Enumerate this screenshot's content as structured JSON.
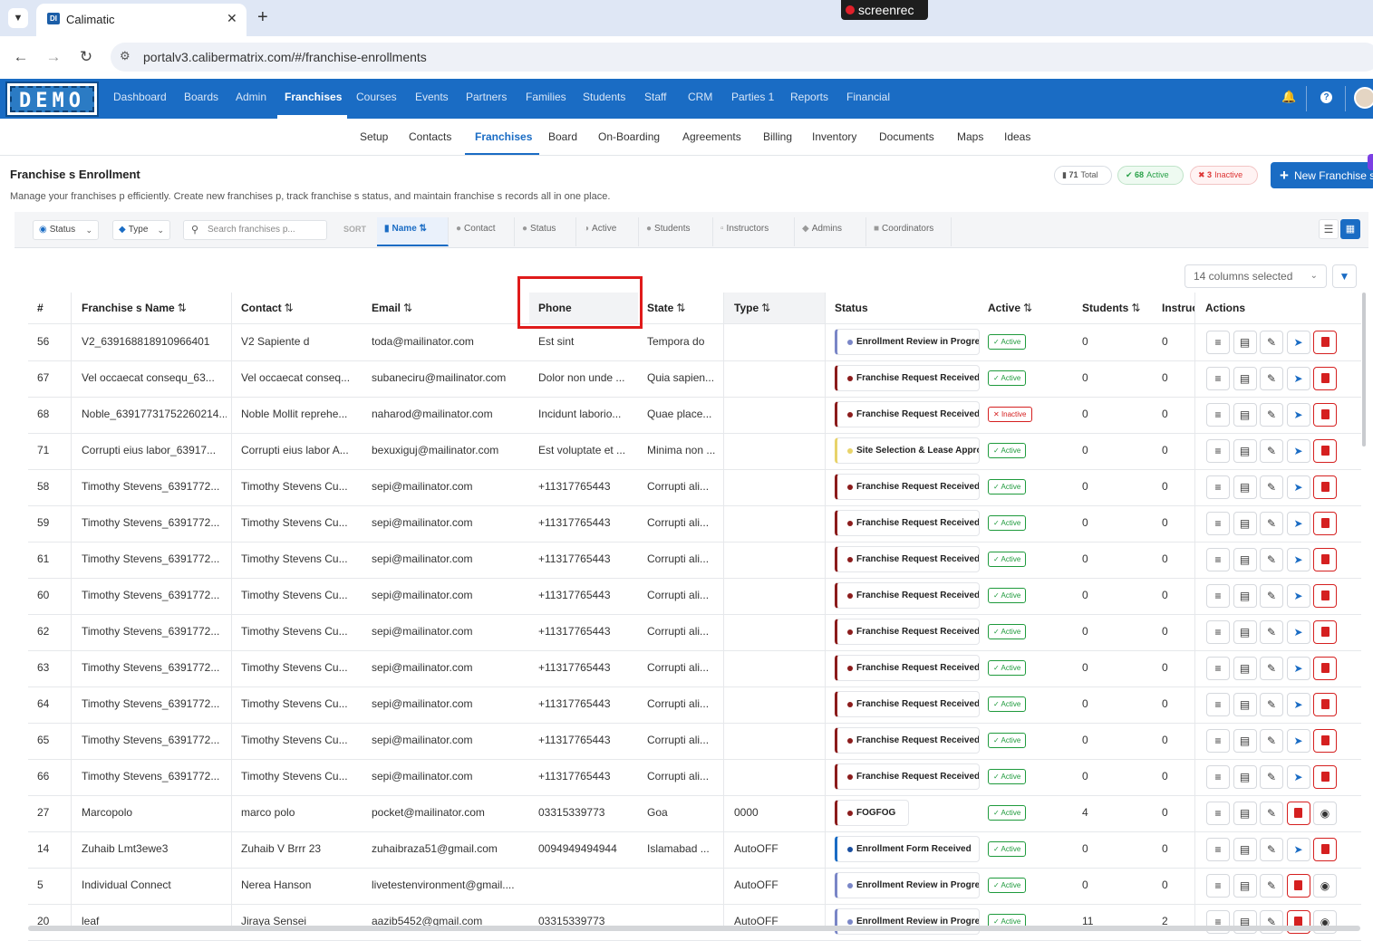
{
  "browser": {
    "tab_title": "Calimatic",
    "favicon_text": "DI",
    "url": "portalv3.calibermatrix.com/#/franchise-enrollments",
    "recorder_label": "screenrec"
  },
  "brand": {
    "logo_text": "DEMO",
    "primary_color": "#1a6cc4"
  },
  "top_nav": [
    "Dashboard",
    "Boards",
    "Admin",
    "Franchises",
    "Courses",
    "Events",
    "Partners",
    "Families",
    "Students",
    "Staff",
    "CRM",
    "Parties 1",
    "Reports",
    "Financial"
  ],
  "top_nav_active": "Franchises",
  "sub_nav": [
    "Setup",
    "Contacts",
    "Franchises",
    "Board",
    "On-Boarding",
    "Agreements",
    "Billing",
    "Inventory",
    "Documents",
    "Maps",
    "Ideas"
  ],
  "sub_nav_active": "Franchises",
  "page": {
    "title": "Franchise s Enrollment",
    "description": "Manage your franchises p efficiently. Create new franchises p, track franchise s status, and maintain franchise s records all in one place.",
    "total_count": "71",
    "total_label": "Total",
    "active_count": "68",
    "active_label": "Active",
    "inactive_count": "3",
    "inactive_label": "Inactive",
    "new_button": "New Franchise s"
  },
  "toolbar": {
    "status_filter": "Status",
    "type_filter": "Type",
    "search_placeholder": "Search franchises p...",
    "sort_label": "SORT",
    "sort_options": [
      "Name",
      "Contact",
      "Status",
      "Active",
      "Students",
      "Instructors",
      "Admins",
      "Coordinators"
    ],
    "sort_active": "Name"
  },
  "columns_selected": "14 columns selected",
  "table": {
    "headers": {
      "num": "#",
      "name": "Franchise s Name",
      "contact": "Contact",
      "email": "Email",
      "phone": "Phone",
      "state": "State",
      "type": "Type",
      "status": "Status",
      "active": "Active",
      "students": "Students",
      "instructors": "Instruc",
      "actions": "Actions"
    },
    "rows": [
      {
        "num": "56",
        "name": "V2_639168818910966401",
        "contact": "V2 Sapiente d",
        "email": "toda@mailinator.com",
        "phone": "Est sint",
        "state": "Tempora do",
        "type": "",
        "status": "Enrollment Review in Progress",
        "status_color": "#7a86c7",
        "dot": "#7a86c7",
        "active": "Active",
        "students": "0",
        "instructors": "0",
        "last": "send"
      },
      {
        "num": "67",
        "name": "Vel occaecat consequ_63...",
        "contact": "Vel occaecat conseq...",
        "email": "subaneciru@mailinator.com",
        "phone": "Dolor non unde ...",
        "state": "Quia sapien...",
        "type": "",
        "status": "Franchise Request Received",
        "status_color": "#8b1c1c",
        "dot": "#8b1c1c",
        "active": "Active",
        "students": "0",
        "instructors": "0",
        "last": "send"
      },
      {
        "num": "68",
        "name": "Noble_63917731752260214...",
        "contact": "Noble Mollit reprehe...",
        "email": "naharod@mailinator.com",
        "phone": "Incidunt laborio...",
        "state": "Quae place...",
        "type": "",
        "status": "Franchise Request Received",
        "status_color": "#8b1c1c",
        "dot": "#8b1c1c",
        "active": "Inactive",
        "students": "0",
        "instructors": "0",
        "last": "send"
      },
      {
        "num": "71",
        "name": "Corrupti eius labor_63917...",
        "contact": "Corrupti eius labor A...",
        "email": "bexuxiguj@mailinator.com",
        "phone": "Est voluptate et ...",
        "state": "Minima non ...",
        "type": "",
        "status": "Site Selection & Lease Approval",
        "status_color": "#e8d36a",
        "dot": "#e8d36a",
        "active": "Active",
        "students": "0",
        "instructors": "0",
        "last": "send"
      },
      {
        "num": "58",
        "name": "Timothy Stevens_6391772...",
        "contact": "Timothy Stevens Cu...",
        "email": "sepi@mailinator.com",
        "phone": "+11317765443",
        "state": "Corrupti ali...",
        "type": "",
        "status": "Franchise Request Received",
        "status_color": "#8b1c1c",
        "dot": "#8b1c1c",
        "active": "Active",
        "students": "0",
        "instructors": "0",
        "last": "send"
      },
      {
        "num": "59",
        "name": "Timothy Stevens_6391772...",
        "contact": "Timothy Stevens Cu...",
        "email": "sepi@mailinator.com",
        "phone": "+11317765443",
        "state": "Corrupti ali...",
        "type": "",
        "status": "Franchise Request Received",
        "status_color": "#8b1c1c",
        "dot": "#8b1c1c",
        "active": "Active",
        "students": "0",
        "instructors": "0",
        "last": "send"
      },
      {
        "num": "61",
        "name": "Timothy Stevens_6391772...",
        "contact": "Timothy Stevens Cu...",
        "email": "sepi@mailinator.com",
        "phone": "+11317765443",
        "state": "Corrupti ali...",
        "type": "",
        "status": "Franchise Request Received",
        "status_color": "#8b1c1c",
        "dot": "#8b1c1c",
        "active": "Active",
        "students": "0",
        "instructors": "0",
        "last": "send"
      },
      {
        "num": "60",
        "name": "Timothy Stevens_6391772...",
        "contact": "Timothy Stevens Cu...",
        "email": "sepi@mailinator.com",
        "phone": "+11317765443",
        "state": "Corrupti ali...",
        "type": "",
        "status": "Franchise Request Received",
        "status_color": "#8b1c1c",
        "dot": "#8b1c1c",
        "active": "Active",
        "students": "0",
        "instructors": "0",
        "last": "send"
      },
      {
        "num": "62",
        "name": "Timothy Stevens_6391772...",
        "contact": "Timothy Stevens Cu...",
        "email": "sepi@mailinator.com",
        "phone": "+11317765443",
        "state": "Corrupti ali...",
        "type": "",
        "status": "Franchise Request Received",
        "status_color": "#8b1c1c",
        "dot": "#8b1c1c",
        "active": "Active",
        "students": "0",
        "instructors": "0",
        "last": "send"
      },
      {
        "num": "63",
        "name": "Timothy Stevens_6391772...",
        "contact": "Timothy Stevens Cu...",
        "email": "sepi@mailinator.com",
        "phone": "+11317765443",
        "state": "Corrupti ali...",
        "type": "",
        "status": "Franchise Request Received",
        "status_color": "#8b1c1c",
        "dot": "#8b1c1c",
        "active": "Active",
        "students": "0",
        "instructors": "0",
        "last": "send"
      },
      {
        "num": "64",
        "name": "Timothy Stevens_6391772...",
        "contact": "Timothy Stevens Cu...",
        "email": "sepi@mailinator.com",
        "phone": "+11317765443",
        "state": "Corrupti ali...",
        "type": "",
        "status": "Franchise Request Received",
        "status_color": "#8b1c1c",
        "dot": "#8b1c1c",
        "active": "Active",
        "students": "0",
        "instructors": "0",
        "last": "send"
      },
      {
        "num": "65",
        "name": "Timothy Stevens_6391772...",
        "contact": "Timothy Stevens Cu...",
        "email": "sepi@mailinator.com",
        "phone": "+11317765443",
        "state": "Corrupti ali...",
        "type": "",
        "status": "Franchise Request Received",
        "status_color": "#8b1c1c",
        "dot": "#8b1c1c",
        "active": "Active",
        "students": "0",
        "instructors": "0",
        "last": "send"
      },
      {
        "num": "66",
        "name": "Timothy Stevens_6391772...",
        "contact": "Timothy Stevens Cu...",
        "email": "sepi@mailinator.com",
        "phone": "+11317765443",
        "state": "Corrupti ali...",
        "type": "",
        "status": "Franchise Request Received",
        "status_color": "#8b1c1c",
        "dot": "#8b1c1c",
        "active": "Active",
        "students": "0",
        "instructors": "0",
        "last": "send"
      },
      {
        "num": "27",
        "name": "Marcopolo",
        "contact": "marco polo",
        "email": "pocket@mailinator.com",
        "phone": "03315339773",
        "state": "Goa",
        "type": "0000",
        "status": "FOGFOG",
        "status_color": "#8b1c1c",
        "dot": "#8b1c1c",
        "active": "Active",
        "students": "4",
        "instructors": "0",
        "last": "view"
      },
      {
        "num": "14",
        "name": "Zuhaib Lmt3ewe3",
        "contact": "Zuhaib V Brrr 23",
        "email": "zuhaibraza51@gmail.com",
        "phone": "0094949494944",
        "state": "Islamabad ...",
        "type": "AutoOFF",
        "status": "Enrollment Form Received",
        "status_color": "#1a6cc4",
        "dot": "#1a4fa0",
        "active": "Active",
        "students": "0",
        "instructors": "0",
        "last": "send"
      },
      {
        "num": "5",
        "name": "Individual Connect",
        "contact": "Nerea Hanson",
        "email": "livetestenvironment@gmail....",
        "phone": "",
        "state": "",
        "type": "AutoOFF",
        "status": "Enrollment Review in Progress",
        "status_color": "#7a86c7",
        "dot": "#7a86c7",
        "active": "Active",
        "students": "0",
        "instructors": "0",
        "last": "view"
      },
      {
        "num": "20",
        "name": "leaf",
        "contact": "Jiraya Sensei",
        "email": "aazib5452@gmail.com",
        "phone": "03315339773",
        "state": "",
        "type": "AutoOFF",
        "status": "Enrollment Review in Progress",
        "status_color": "#7a86c7",
        "dot": "#7a86c7",
        "active": "Active",
        "students": "11",
        "instructors": "2",
        "last": "view"
      }
    ]
  }
}
